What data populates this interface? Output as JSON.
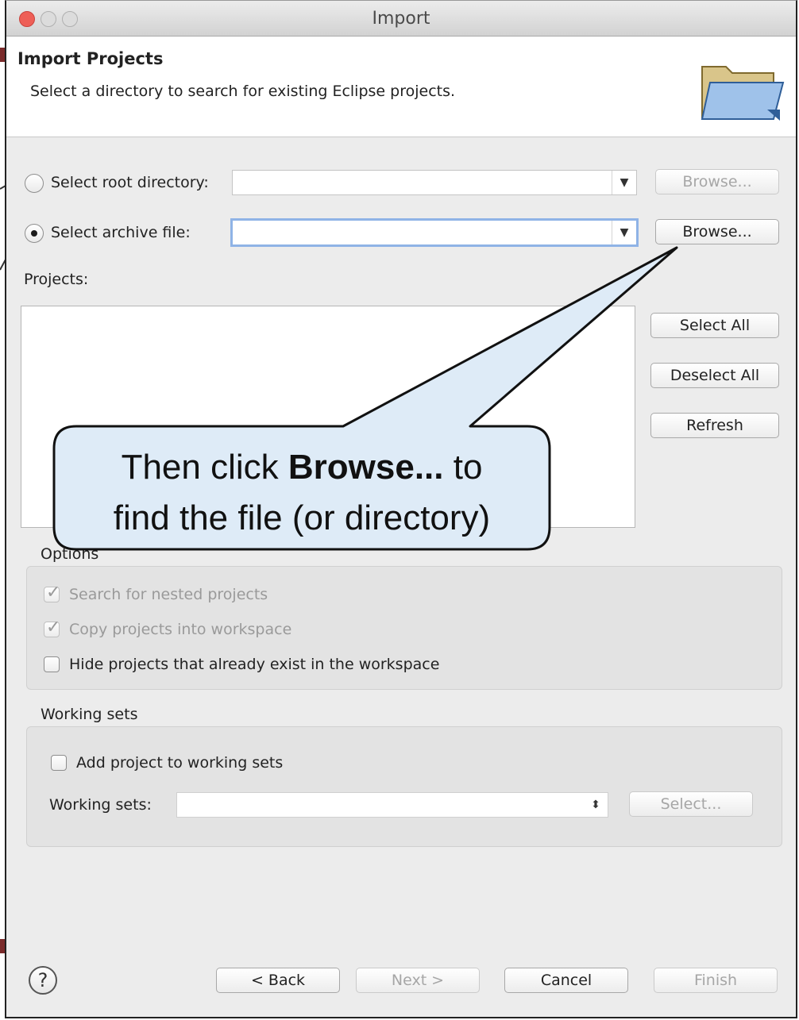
{
  "window": {
    "title": "Import"
  },
  "header": {
    "title": "Import Projects",
    "subtitle": "Select a directory to search for existing Eclipse projects."
  },
  "source": {
    "root_label": "Select root directory:",
    "archive_label": "Select archive file:",
    "browse_root": "Browse...",
    "browse_archive": "Browse..."
  },
  "projects": {
    "label": "Projects:",
    "select_all": "Select All",
    "deselect_all": "Deselect All",
    "refresh": "Refresh"
  },
  "options": {
    "legend": "Options",
    "nested": "Search for nested projects",
    "copy": "Copy projects into workspace",
    "hide": "Hide projects that already exist in the workspace"
  },
  "working_sets": {
    "legend": "Working sets",
    "add": "Add project to working sets",
    "label": "Working sets:",
    "select": "Select..."
  },
  "footer": {
    "back": "< Back",
    "next": "Next >",
    "cancel": "Cancel",
    "finish": "Finish"
  },
  "callout": {
    "line1_pre": "Then click ",
    "line1_bold": "Browse...",
    "line1_post": " to",
    "line2": "find the file (or directory)"
  },
  "colors": {
    "close": "#ee5f57",
    "minimize": "#d9d9d9",
    "zoom": "#d9d9d9",
    "callout_fill": "#deebf7"
  },
  "icons": [
    "folder-icon",
    "help-icon",
    "checkmark-icon",
    "dropdown-arrow-icon"
  ]
}
